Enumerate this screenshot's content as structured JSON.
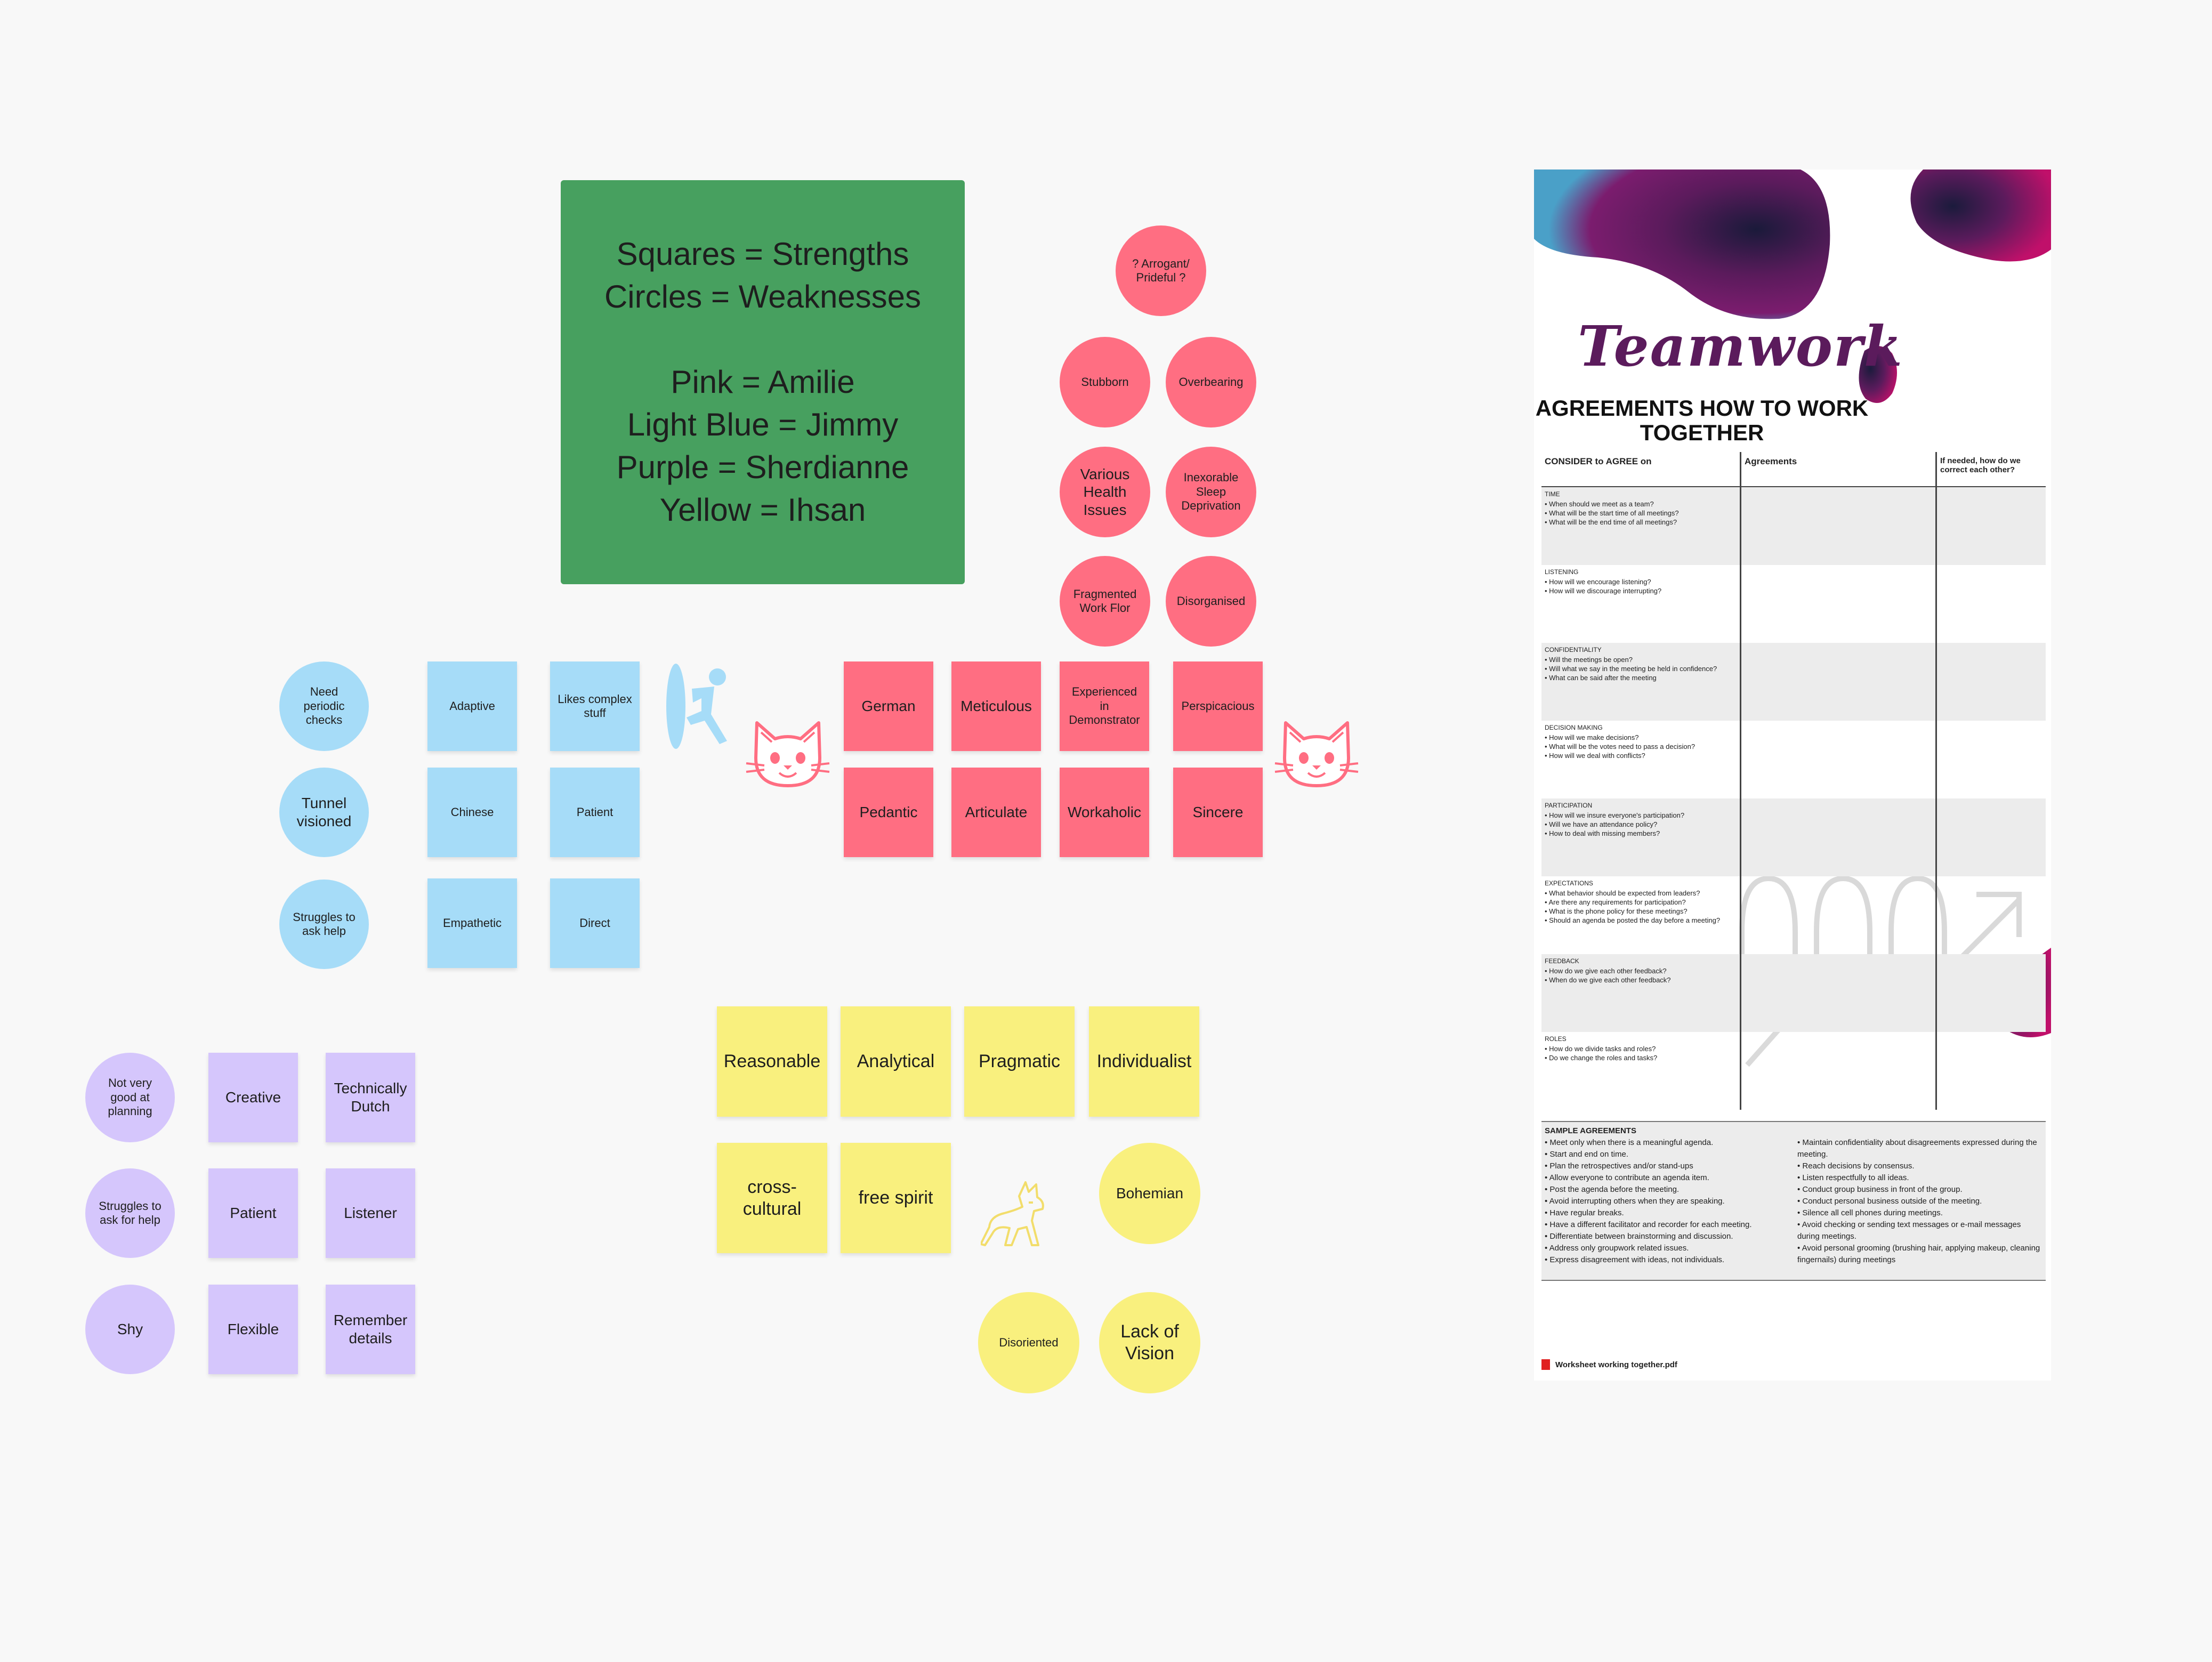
{
  "legend": {
    "lines": [
      "Squares  = Strengths",
      "Circles = Weaknesses",
      "Pink = Amilie",
      "Light Blue = Jimmy",
      "Purple = Sherdianne",
      "Yellow = Ihsan"
    ]
  },
  "colors": {
    "legend_bg": "#47a05f",
    "pink": "#ff6e82",
    "light_blue": "#a6dcf8",
    "purple": "#d5c6fc",
    "yellow": "#f9f07e"
  },
  "pink": {
    "weaknesses": [
      "? Arrogant/ Prideful ?",
      "Stubborn",
      "Overbearing",
      "Various Health Issues",
      "Inexorable Sleep Deprivation",
      "Fragmented Work Flor",
      "Disorganised"
    ],
    "strengths": [
      "German",
      "Meticulous",
      "Experienced in Demonstrator",
      "Perspicacious",
      "Pedantic",
      "Articulate",
      "Workaholic",
      "Sincere"
    ]
  },
  "blue": {
    "weaknesses": [
      "Need periodic checks",
      "Tunnel visioned",
      "Struggles to ask help"
    ],
    "strengths": [
      "Adaptive",
      "Likes complex stuff",
      "Chinese",
      "Patient",
      "Empathetic",
      "Direct"
    ]
  },
  "purple": {
    "weaknesses": [
      "Not very good at planning",
      "Struggles to ask for help",
      "Shy"
    ],
    "strengths": [
      "Creative",
      "Technically Dutch",
      "Patient",
      "Listener",
      "Flexible",
      "Remember details"
    ]
  },
  "yellow": {
    "strengths": [
      "Reasonable",
      "Analytical",
      "Pragmatic",
      "Individualist",
      "cross-cultural",
      "free spirit"
    ],
    "weaknesses": [
      "Bohemian",
      "Disoriented",
      "Lack of Vision"
    ]
  },
  "icons": [
    "surfer-icon",
    "cat-face-icon-left",
    "cat-face-icon-right",
    "wolf-icon"
  ],
  "worksheet": {
    "title": "Teamwork",
    "heading": "AGREEMENTS HOW TO WORK TOGETHER",
    "col1": "CONSIDER to AGREE on",
    "col2": "Agreements",
    "col3": "If needed, how do we correct each other?",
    "sections": [
      {
        "title": "TIME",
        "questions": [
          "• When should we meet as a team?",
          "• What will be the start time of all meetings?",
          "• What will be the end time of all meetings?"
        ]
      },
      {
        "title": "LISTENING",
        "questions": [
          "• How will we encourage listening?",
          "• How will we discourage interrupting?"
        ]
      },
      {
        "title": "CONFIDENTIALITY",
        "questions": [
          "• Will the meetings be open?",
          "• Will what we say in the meeting be held in confidence?",
          "• What can be said after the meeting"
        ]
      },
      {
        "title": "DECISION MAKING",
        "questions": [
          "• How will we make decisions?",
          "• What will be the votes need to pass a decision?",
          "• How will we deal with conflicts?"
        ]
      },
      {
        "title": "PARTICIPATION",
        "questions": [
          "• How will we insure everyone's participation?",
          "• Will we have an attendance policy?",
          "• How to deal with missing members?"
        ]
      },
      {
        "title": "EXPECTATIONS",
        "questions": [
          "• What behavior should be expected from leaders?",
          "• Are there any requirements for participation?",
          "• What is the phone policy for these meetings?",
          "• Should an agenda be posted the day before a meeting?"
        ]
      },
      {
        "title": "FEEDBACK",
        "questions": [
          "• How do we give each other feedback?",
          "• When do we give each other feedback?"
        ]
      },
      {
        "title": "ROLES",
        "questions": [
          "• How do we divide tasks and roles?",
          "• Do we change the roles and tasks?"
        ]
      }
    ],
    "samples_title": "SAMPLE AGREEMENTS",
    "samples_left": [
      "• Meet only when there is a meaningful agenda.",
      "• Start and end on time.",
      "• Plan the retrospectives and/or stand-ups",
      "• Allow everyone to contribute an agenda item.",
      "• Post the agenda before the meeting.",
      "• Avoid interrupting others when they are speaking.",
      "• Have regular breaks.",
      "• Have a different facilitator and recorder for each meeting.",
      "• Differentiate between brainstorming and discussion.",
      "• Address only groupwork related issues.",
      "• Express disagreement with ideas, not individuals."
    ],
    "samples_right": [
      "• Maintain confidentiality about disagreements expressed during the meeting.",
      "• Reach decisions by consensus.",
      "• Listen respectfully to all ideas.",
      "• Conduct group business in front of the group.",
      "• Conduct personal business outside of the meeting.",
      "• Silence all cell phones during meetings.",
      "• Avoid checking or sending text messages or e-mail messages during meetings.",
      "• Avoid personal grooming (brushing hair, applying makeup, cleaning fingernails) during meetings"
    ],
    "filename": "Worksheet working together.pdf"
  }
}
